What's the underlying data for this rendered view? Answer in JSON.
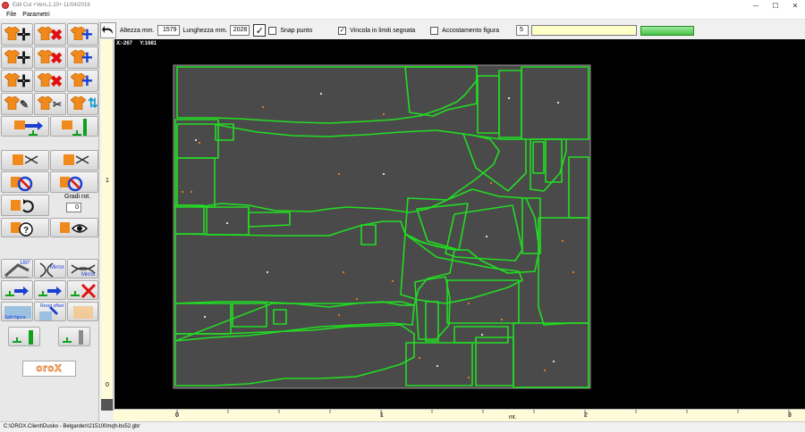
{
  "window": {
    "title": "Edit Cut +Vers.1.10+ 11/04/2019",
    "minimize": "─",
    "maximize": "☐",
    "close": "✕"
  },
  "menu": {
    "items": [
      "File",
      "Parametri"
    ]
  },
  "toolbar": {
    "altezza_label": "Altezza mm.",
    "altezza_value": "1579",
    "lunghezza_label": "Lunghezza mm.",
    "lunghezza_value": "2028",
    "snap_label": "Snap punto",
    "snap_checked": false,
    "vincola_label": "Vincola in limiti segnata",
    "vincola_checked": true,
    "accostamento_label": "Accostamento figura",
    "accostamento_checked": false,
    "accostamento_value": "5",
    "text_field_value": "",
    "progress": 0
  },
  "left_panel": {
    "gradi_rot_label": "Gradi rot.",
    "gradi_rot_value": "0",
    "rotate_180_label": "180°",
    "mirror_label_1": "Mirror",
    "mirror_label_2": "Mirror",
    "reset_offset_label": "Reset offset",
    "split_label": "Split figura",
    "logo": "oroX",
    "colors": {
      "shirt": "#f08a1c",
      "red": "#e01010",
      "blue": "#1a3fd0",
      "green": "#10a020"
    }
  },
  "canvas": {
    "coords": "X:-267     Y:1681",
    "colors": {
      "background": "#000000",
      "sheet": "#4a4a4a",
      "outline": "#22dd22",
      "frame": "#9a9a9a",
      "dots": "#e07a20"
    }
  },
  "rulers": {
    "left_labels": [
      "1",
      "0"
    ],
    "bottom_labels": [
      "0",
      "1",
      "2",
      "3"
    ],
    "unit": "mt."
  },
  "status": {
    "path": "C:\\OROX.Client\\Dusko - Belgarden\\215100mqh-bs52.gbr"
  }
}
